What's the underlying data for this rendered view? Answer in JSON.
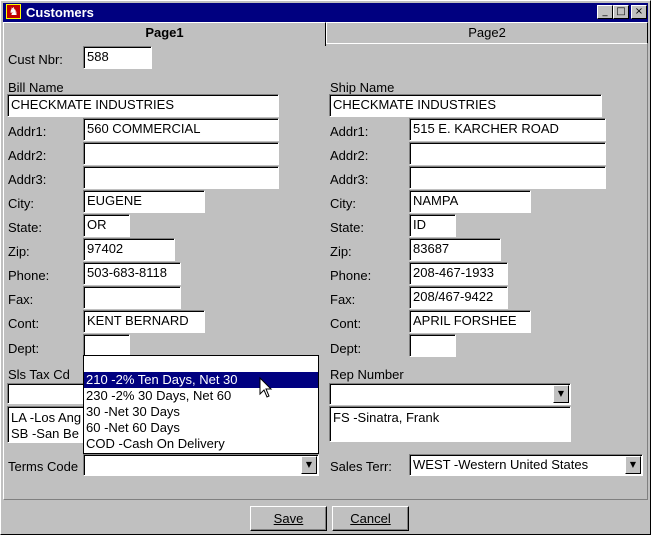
{
  "window": {
    "title": "Customers",
    "min": "_",
    "max": "□",
    "close": "×",
    "app_icon": "checkmate-app-icon"
  },
  "tabs": [
    {
      "label": "Page1",
      "active": true
    },
    {
      "label": "Page2",
      "active": false
    }
  ],
  "cust": {
    "label": "Cust Nbr:",
    "value": "588"
  },
  "bill": {
    "name_label": "Bill Name",
    "name": "CHECKMATE INDUSTRIES",
    "addr1_label": "Addr1:",
    "addr1": "560 COMMERCIAL",
    "addr2_label": "Addr2:",
    "addr2": "",
    "addr3_label": "Addr3:",
    "addr3": "",
    "city_label": "City:",
    "city": "EUGENE",
    "state_label": "State:",
    "state": "OR",
    "zip_label": "Zip:",
    "zip": "97402",
    "phone_label": "Phone:",
    "phone": "503-683-8118",
    "fax_label": "Fax:",
    "fax": "",
    "cont_label": "Cont:",
    "cont": "KENT BERNARD",
    "dept_label": "Dept:",
    "dept": ""
  },
  "ship": {
    "name_label": "Ship Name",
    "name": "CHECKMATE INDUSTRIES",
    "addr1_label": "Addr1:",
    "addr1": "515 E. KARCHER ROAD",
    "addr2_label": "Addr2:",
    "addr2": "",
    "addr3_label": "Addr3:",
    "addr3": "",
    "city_label": "City:",
    "city": "NAMPA",
    "state_label": "State:",
    "state": "ID",
    "zip_label": "Zip:",
    "zip": "83687",
    "phone_label": "Phone:",
    "phone": "208-467-1933",
    "fax_label": "Fax:",
    "fax": "208/467-9422",
    "cont_label": "Cont:",
    "cont": "APRIL FORSHEE",
    "dept_label": "Dept:",
    "dept": ""
  },
  "sls_tax": {
    "label": "Sls Tax Cd",
    "value": "",
    "list": [
      "LA -Los Ang",
      "SB -San Be"
    ]
  },
  "rep": {
    "label": "Rep Number",
    "value": "",
    "list": [
      "FS -Sinatra, Frank"
    ]
  },
  "terms": {
    "label": "Terms Code",
    "value": "",
    "options": [
      {
        "text": "",
        "selected": false
      },
      {
        "text": "210 -2% Ten Days, Net 30",
        "selected": true
      },
      {
        "text": "230 -2% 30 Days, Net 60",
        "selected": false
      },
      {
        "text": "30 -Net 30 Days",
        "selected": false
      },
      {
        "text": "60 -Net 60 Days",
        "selected": false
      },
      {
        "text": "COD -Cash On Delivery",
        "selected": false
      }
    ]
  },
  "sales_terr": {
    "label": "Sales Terr:",
    "value": "WEST -Western United States"
  },
  "buttons": {
    "save": "Save",
    "cancel": "Cancel"
  },
  "colors": {
    "titlebar": "#000080",
    "face": "#c0c0c0",
    "selection": "#000080"
  }
}
